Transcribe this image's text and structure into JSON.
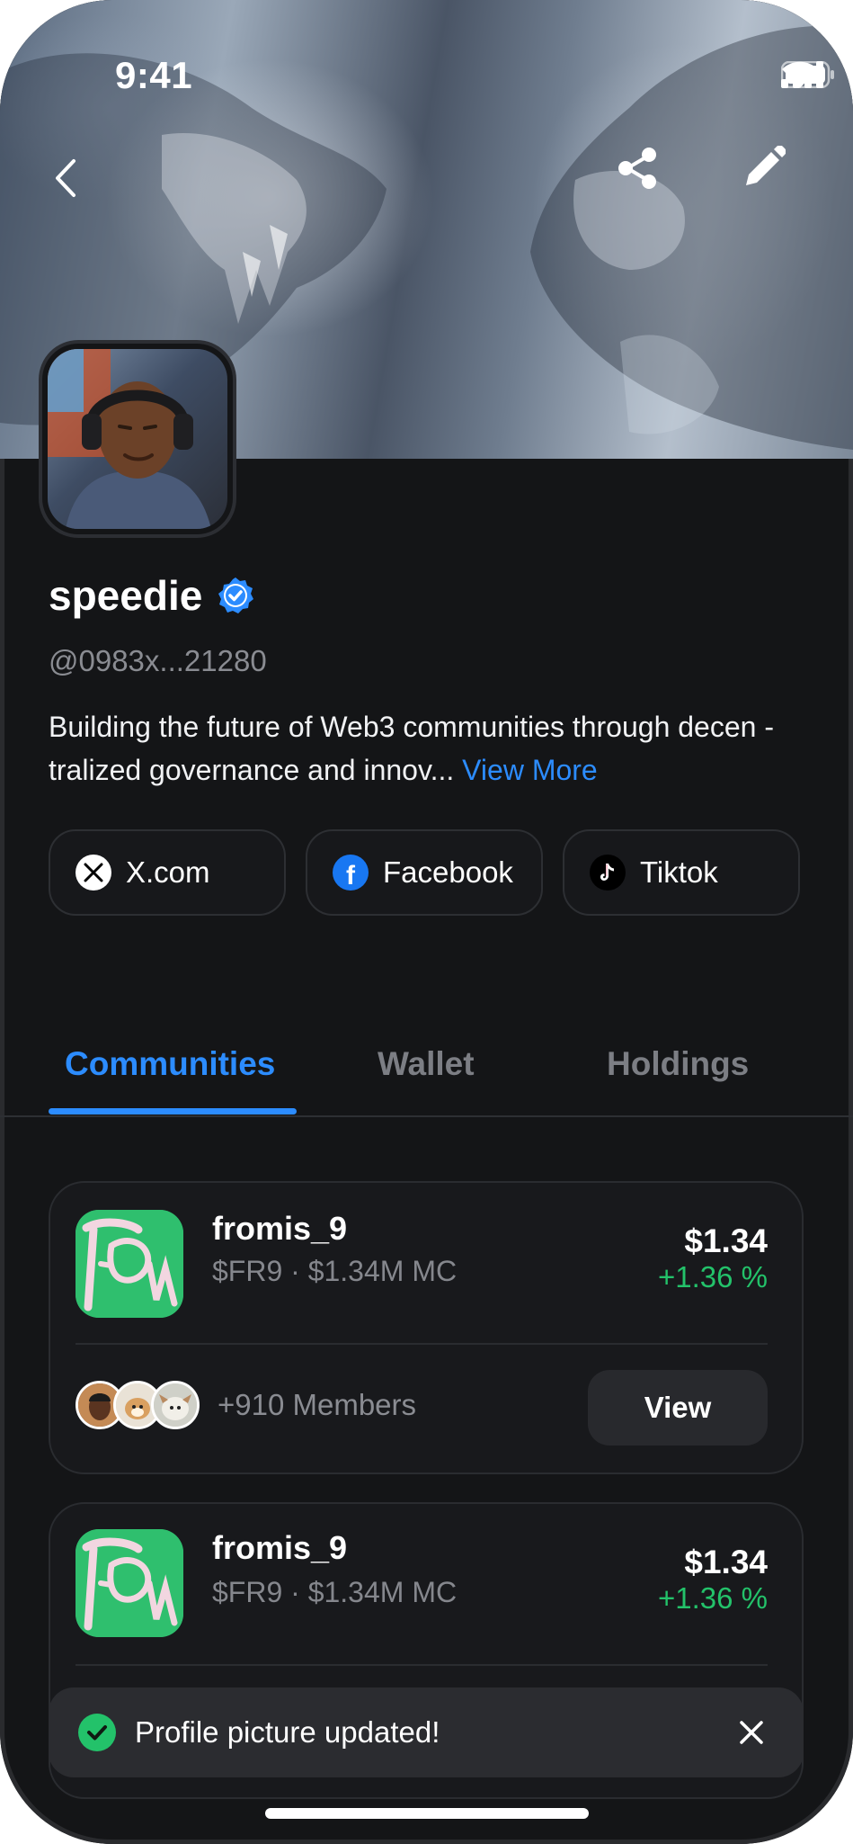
{
  "status_bar": {
    "time": "9:41"
  },
  "header": {
    "icons": [
      "back-chevron-icon",
      "share-icon",
      "edit-pencil-icon"
    ]
  },
  "profile": {
    "name": "speedie",
    "verified": true,
    "handle": "@0983x...21280",
    "bio": "Building the future of Web3 communities through decen - tralized governance and innov...",
    "view_more": "View More"
  },
  "socials": [
    {
      "label": "X.com",
      "icon": "x-logo-icon"
    },
    {
      "label": "Facebook",
      "icon": "facebook-logo-icon"
    },
    {
      "label": "Tiktok",
      "icon": "tiktok-logo-icon"
    }
  ],
  "tabs": [
    {
      "label": "Communities",
      "active": true
    },
    {
      "label": "Wallet",
      "active": false
    },
    {
      "label": "Holdings",
      "active": false
    }
  ],
  "communities": [
    {
      "name": "fromis_9",
      "subtitle": "$FR9 · $1.34M MC",
      "price": "$1.34",
      "change": "+1.36 %",
      "members": "+910 Members",
      "action": "View"
    },
    {
      "name": "fromis_9",
      "subtitle": "$FR9 · $1.34M MC",
      "price": "$1.34",
      "change": "+1.36 %"
    }
  ],
  "toast": {
    "message": "Profile picture updated!"
  },
  "colors": {
    "accent": "#2c8cff",
    "positive": "#23c26a",
    "background": "#141517",
    "card": "#18191c"
  }
}
